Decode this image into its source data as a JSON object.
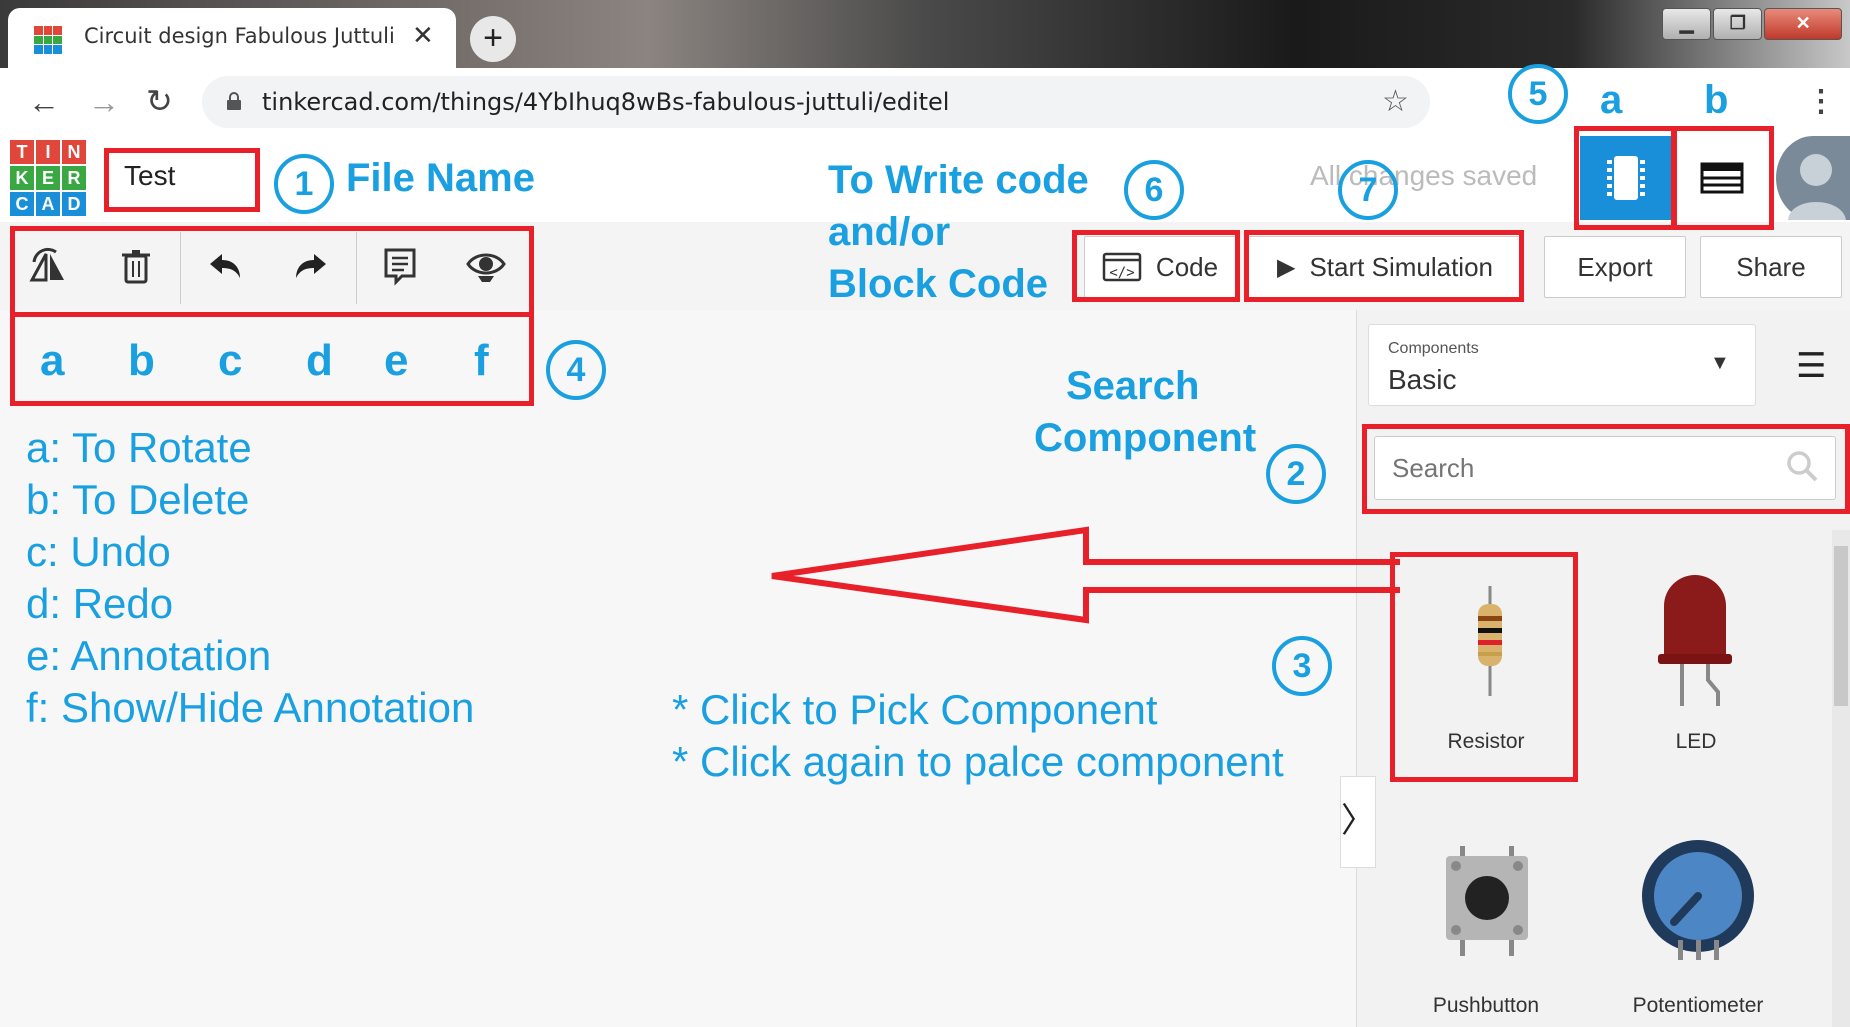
{
  "browser": {
    "tab_title": "Circuit design Fabulous Juttuli | T",
    "tab_close": "✕",
    "new_tab": "+",
    "url": "tinkercad.com/things/4YbIhuq8wBs-fabulous-juttuli/editel",
    "window_buttons": [
      "▁",
      "❐",
      "✕"
    ]
  },
  "header": {
    "logo_letters": [
      "T",
      "I",
      "N",
      "K",
      "E",
      "R",
      "C",
      "A",
      "D"
    ],
    "file_name": "Test",
    "save_status": "All changes saved",
    "avatar_icon": "user-avatar"
  },
  "toolbar": {
    "code_label": "Code",
    "start_simulation_label": "Start Simulation",
    "export_label": "Export",
    "share_label": "Share"
  },
  "panel": {
    "components_label": "Components",
    "components_value": "Basic",
    "search_placeholder": "Search",
    "components": [
      {
        "name": "Resistor"
      },
      {
        "name": "LED"
      },
      {
        "name": "Pushbutton"
      },
      {
        "name": "Potentiometer"
      }
    ]
  },
  "annotations": {
    "circle_1": "1",
    "file_name_label": "File Name",
    "circle_2": "2",
    "search_component_line1": "Search",
    "search_component_line2": "Component",
    "circle_3": "3",
    "circle_4": "4",
    "circle_5": "5",
    "view_a": "a",
    "view_b": "b",
    "circle_6": "6",
    "circle_7": "7",
    "write_code_line1": "To Write code",
    "write_code_line2": "and/or",
    "write_code_line3": "Block Code",
    "toolbar_letters": [
      "a",
      "b",
      "c",
      "d",
      "e",
      "f"
    ],
    "legend": [
      "a: To Rotate",
      "b: To Delete",
      "c: Undo",
      "d: Redo",
      "e: Annotation",
      "f: Show/Hide Annotation"
    ],
    "pick_line1": "* Click to Pick Component",
    "pick_line2": "* Click again to palce component"
  },
  "colors": {
    "annotation_blue": "#1aa0e0",
    "annotation_red": "#e8202a",
    "tinkercad_blue": "#1a8fd9"
  }
}
